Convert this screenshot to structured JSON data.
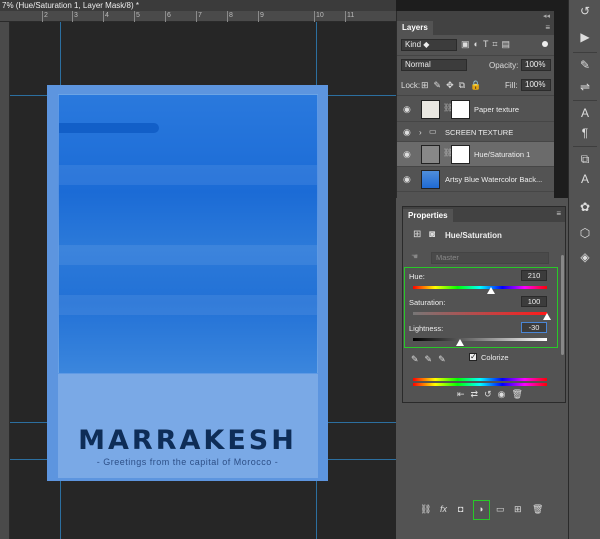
{
  "document": {
    "tab_title": "7% (Hue/Saturation 1, Layer Mask/8) *",
    "ruler_marks": [
      "2",
      "3",
      "4",
      "5",
      "6",
      "7",
      "8",
      "9",
      "10",
      "11"
    ]
  },
  "poster": {
    "title": "MARRAKESH",
    "subtitle": "- Greetings from the capital of Morocco -"
  },
  "layers_panel": {
    "tab_label": "Layers",
    "kind_filter": "Kind",
    "blend_mode": "Normal",
    "opacity_label": "Opacity:",
    "opacity_value": "100%",
    "lock_label": "Lock:",
    "fill_label": "Fill:",
    "fill_value": "100%",
    "layers": [
      {
        "name": "Paper texture",
        "type": "pixel",
        "selected": false
      },
      {
        "name": "SCREEN TEXTURE",
        "type": "group",
        "selected": false
      },
      {
        "name": "Hue/Saturation 1",
        "type": "adjustment",
        "selected": true
      },
      {
        "name": "Artsy Blue Watercolor Back...",
        "type": "smart-object",
        "selected": false
      }
    ]
  },
  "properties_panel": {
    "tab_label": "Properties",
    "adjustment_title": "Hue/Saturation",
    "preset": "Master",
    "hue_label": "Hue:",
    "hue_value": "210",
    "saturation_label": "Saturation:",
    "saturation_value": "100",
    "lightness_label": "Lightness:",
    "lightness_value": "-30",
    "colorize_label": "Colorize",
    "colorize_checked": true,
    "hue_level_fraction": 0.583,
    "saturation_level_fraction": 1.0,
    "lightness_level_fraction": 0.35
  },
  "colors": {
    "highlight": "#28c828",
    "guide": "#2f8fd4",
    "poster_blue": "#2271d6"
  }
}
